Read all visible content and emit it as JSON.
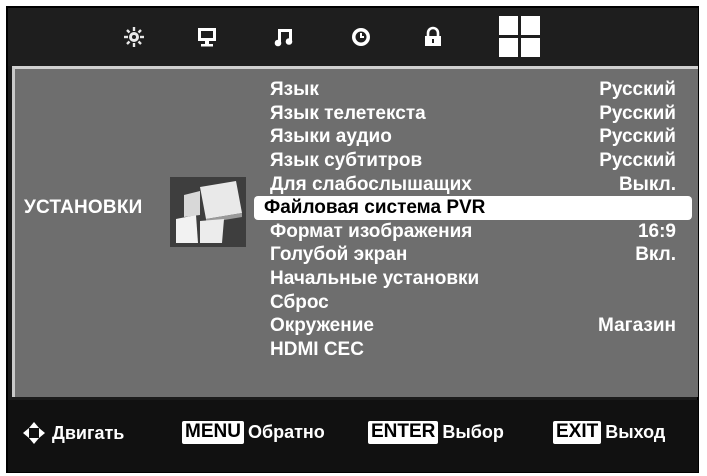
{
  "tabs": [
    {
      "name": "picture-icon"
    },
    {
      "name": "display-icon"
    },
    {
      "name": "music-icon"
    },
    {
      "name": "clock-icon"
    },
    {
      "name": "lock-icon"
    },
    {
      "name": "setup-grid-icon",
      "active": true
    }
  ],
  "section": {
    "title": "УСТАНОВКИ"
  },
  "menu": {
    "items": [
      {
        "label": "Язык",
        "value": "Русский"
      },
      {
        "label": "Язык телетекста",
        "value": "Русский"
      },
      {
        "label": "Языки аудио",
        "value": "Русский"
      },
      {
        "label": "Язык субтитров",
        "value": "Русский"
      },
      {
        "label": "Для слабослышащих",
        "value": "Выкл."
      },
      {
        "label": "Файловая система PVR",
        "value": ""
      },
      {
        "label": "Формат изображения",
        "value": "16:9"
      },
      {
        "label": "Голубой экран",
        "value": "Вкл."
      },
      {
        "label": "Начальные установки",
        "value": ""
      },
      {
        "label": "Сброс",
        "value": ""
      },
      {
        "label": "Окружение",
        "value": "Магазин"
      },
      {
        "label": "HDMI CEC",
        "value": ""
      }
    ],
    "selected_index": 5
  },
  "footer": {
    "move_label": "Двигать",
    "menu_key": "MENU",
    "menu_label": "Обратно",
    "enter_key": "ENTER",
    "enter_label": "Выбор",
    "exit_key": "EXIT",
    "exit_label": "Выход"
  },
  "colors": {
    "panel_bg": "#6e6e6e",
    "frame_bg": "#1b1b1b",
    "highlight": "#ffffff",
    "text": "#ffffff"
  }
}
